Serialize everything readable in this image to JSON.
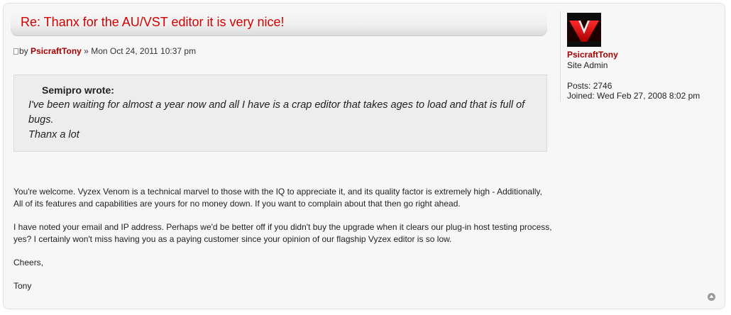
{
  "post": {
    "title": "Re: Thanx for the AU/VST editor it is very nice!",
    "byline": {
      "prefix": "by",
      "author": "PsicraftTony",
      "separator": "»",
      "date": "Mon Oct 24, 2011 10:37 pm"
    },
    "quote": {
      "cite": "Semipro wrote:",
      "lines": [
        "I've been waiting for almost a year now and all I have is a crap editor that takes ages to load and that is full of bugs.",
        "Thanx a lot"
      ]
    },
    "paragraphs": [
      "You're welcome. Vyzex Venom is a technical marvel to those with the IQ to appreciate it, and its quality factor is extremely high - Additionally, All of its features and capabilities are yours for no money down. If you want to complain about that then go right ahead.",
      "I have noted your email and IP address. Perhaps we'd be better off if you didn't buy the upgrade when it clears our plug-in host testing process, yes? I certainly won't miss having you as a paying customer since your opinion of our flagship Vyzex editor is so low.",
      "Cheers,",
      "Tony"
    ]
  },
  "profile": {
    "name": "PsicraftTony",
    "rank": "Site Admin",
    "posts_label": "Posts:",
    "posts": "2746",
    "joined_label": "Joined:",
    "joined": "Wed Feb 27, 2008 8:02 pm"
  },
  "icons": {
    "post_icon": "document-icon",
    "avatar": "red-v-logo",
    "top_link": "arrow-up-circle-icon"
  },
  "colors": {
    "title": "#d40000",
    "author": "#a50000",
    "background": "#f7f7f7",
    "quote_background": "#ededed"
  }
}
